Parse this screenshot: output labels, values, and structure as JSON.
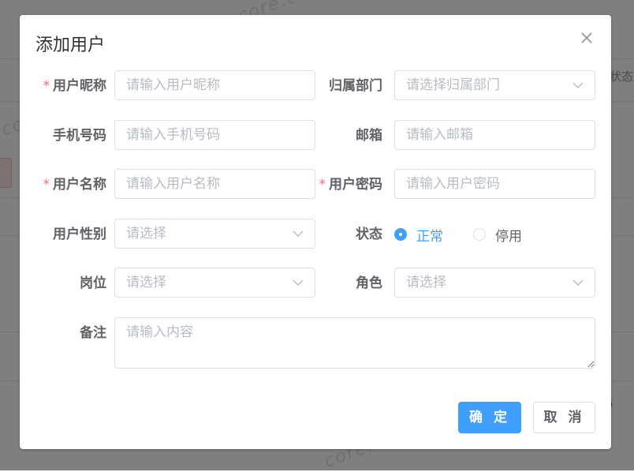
{
  "background": {
    "status_header": "状态",
    "watermark": "core.c",
    "row_tail": "5"
  },
  "dialog": {
    "title": "添加用户",
    "close_icon": "close-icon"
  },
  "form": {
    "nickname": {
      "label": "用户昵称",
      "required": "*",
      "placeholder": "请输入用户昵称"
    },
    "dept": {
      "label": "归属部门",
      "placeholder": "请选择归属部门"
    },
    "phone": {
      "label": "手机号码",
      "placeholder": "请输入手机号码"
    },
    "email": {
      "label": "邮箱",
      "placeholder": "请输入邮箱"
    },
    "username": {
      "label": "用户名称",
      "required": "*",
      "placeholder": "请输入用户名称"
    },
    "password": {
      "label": "用户密码",
      "required": "*",
      "placeholder": "请输入用户密码"
    },
    "gender": {
      "label": "用户性别",
      "placeholder": "请选择"
    },
    "status": {
      "label": "状态",
      "options": [
        "正常",
        "停用"
      ],
      "selected": "正常"
    },
    "post": {
      "label": "岗位",
      "placeholder": "请选择"
    },
    "role": {
      "label": "角色",
      "placeholder": "请选择"
    },
    "remark": {
      "label": "备注",
      "placeholder": "请输入内容"
    }
  },
  "footer": {
    "confirm_label": "确 定",
    "cancel_label": "取 消"
  },
  "colors": {
    "primary": "#409eff",
    "required": "#f56c6c",
    "mask": "rgba(0,0,0,0.5)"
  }
}
